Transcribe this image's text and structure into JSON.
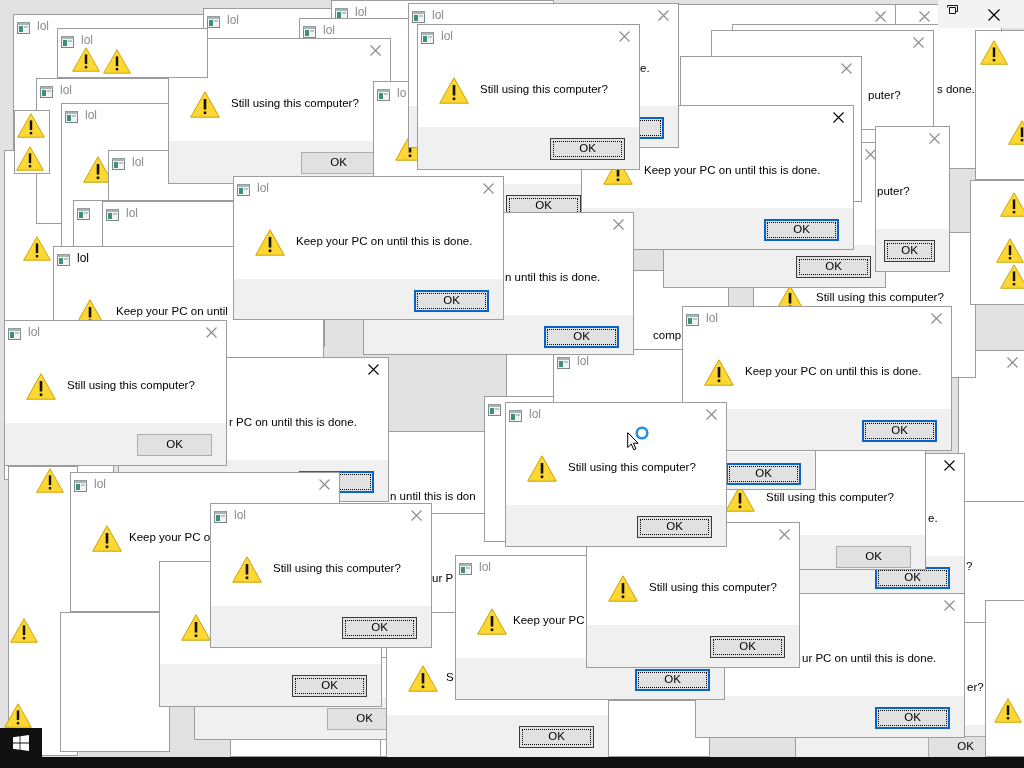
{
  "dialogs": [
    {
      "title": "lol"
    },
    {
      "title": "lol"
    },
    {
      "title": "lol"
    },
    {
      "title": "lol"
    },
    {
      "title": "lol"
    },
    {
      "title": "lol",
      "message": "e.",
      "button": {
        "focused": true,
        "default": true
      },
      "active": false
    },
    {
      "title": "lol"
    },
    {
      "title": "lol"
    },
    {
      "title": "lol"
    },
    {
      "message": "Still using this computer?",
      "button": {
        "label": "OK",
        "focused": false,
        "default": false
      },
      "active": false
    },
    {
      "title": "lo",
      "button": {
        "label": "OK",
        "focused": true,
        "default": false
      }
    },
    {
      "title": "lol",
      "message": "Still using this computer?",
      "button": {
        "label": "OK",
        "focused": true,
        "default": false
      },
      "active": false
    },
    {
      "message": "puter?",
      "active": false
    },
    {
      "message": "s done."
    },
    {
      "title": "lol"
    },
    {
      "title": "lol",
      "message": "Keep your PC on until",
      "active": true
    },
    {
      "title": "lol",
      "message": "Keep your PC on until this is done.",
      "button": {
        "label": "OK",
        "focused": true,
        "default": true
      },
      "active": false
    },
    {
      "message": "Keep your PC on until this is done.",
      "button": {
        "label": "OK",
        "focused": true,
        "default": true
      },
      "active": true
    },
    {
      "message": "puter?",
      "button": {
        "label": "OK",
        "focused": true,
        "default": false
      },
      "active": false
    },
    {
      "message": "n until this is done.",
      "button": {
        "label": "OK",
        "focused": true,
        "default": true
      },
      "active": false
    },
    {
      "button": {
        "label": "OK",
        "focused": true,
        "default": false
      },
      "active": false
    },
    {
      "message": "Still using this computer?"
    },
    {
      "title": "lol",
      "message": "Still using this computer?",
      "button": {
        "label": "OK",
        "focused": false,
        "default": false
      },
      "active": false
    },
    {
      "message": "comp"
    },
    {
      "message": "r PC on until this is done.",
      "button": {
        "focused": true,
        "default": true
      },
      "active": true
    },
    {
      "title": "lol",
      "message": "Keep your PC o",
      "active": false
    },
    {
      "message": "n until this is don"
    },
    {
      "title": "lol",
      "message": "Still using this computer?",
      "button": {
        "label": "OK",
        "focused": true,
        "default": false
      },
      "active": false
    },
    {
      "title": "lol",
      "message": "Still using this computer?",
      "button": {
        "label": "OK",
        "focused": true,
        "default": false
      },
      "active": false
    },
    {
      "title": "lol",
      "button": {
        "label": "OK",
        "focused": true,
        "default": true
      }
    },
    {
      "title": "lol",
      "message": "Keep your PC on until this is done.",
      "button": {
        "label": "OK",
        "focused": true,
        "default": true
      },
      "active": false
    },
    {
      "message": "ur P"
    },
    {
      "title": "lol",
      "message": "Keep your PC",
      "button": {
        "label": "OK",
        "focused": true,
        "default": true
      }
    },
    {
      "message": "Still using this computer?",
      "button": {
        "label": "OK",
        "focused": false,
        "default": false
      }
    },
    {
      "message": "e.",
      "button": {
        "label": "OK",
        "focused": true,
        "default": true
      },
      "active": true
    },
    {
      "message": "?"
    },
    {
      "message": "Still using this computer?",
      "button": {
        "label": "OK",
        "focused": true,
        "default": false
      }
    },
    {
      "button": {
        "label": "OK",
        "focused": true,
        "default": false
      }
    },
    {
      "button": {
        "label": "OK",
        "focused": false,
        "default": false
      }
    },
    {
      "message": "S",
      "button": {
        "label": "OK",
        "focused": true,
        "default": false
      }
    },
    {
      "message": "ur PC on until this is done.",
      "button": {
        "label": "OK",
        "focused": true,
        "default": true
      },
      "active": false
    },
    {
      "message": "er?",
      "button": {
        "label": "OK",
        "focused": false,
        "default": false
      }
    }
  ]
}
